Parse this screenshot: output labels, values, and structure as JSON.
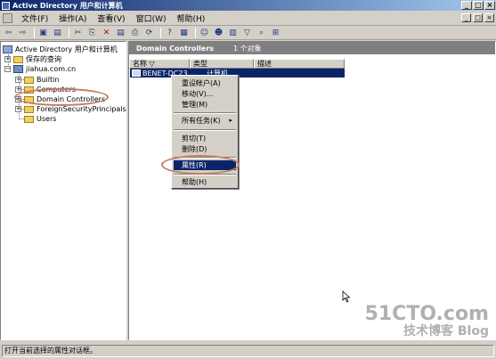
{
  "window": {
    "title": "Active Directory 用户和计算机",
    "minimize": "_",
    "maximize": "□",
    "close": "×"
  },
  "menubar": {
    "items": [
      "文件(F)",
      "操作(A)",
      "查看(V)",
      "窗口(W)",
      "帮助(H)"
    ],
    "controls": [
      "_",
      "□",
      "×"
    ]
  },
  "toolbar": {
    "icons": [
      "back-icon",
      "forward-icon",
      "up-icon",
      "show-tree-icon",
      "cut-icon",
      "copy-icon",
      "delete-icon",
      "properties-icon",
      "export-icon",
      "refresh-icon",
      "help-icon",
      "find-icon",
      "add-user-icon",
      "add-group-icon",
      "add-ou-icon",
      "filter-icon",
      "find-objects-icon",
      "add-to-group-icon"
    ],
    "glyphs": [
      "⇦",
      "⇨",
      "▣",
      "▤",
      "✂",
      "⎘",
      "✕",
      "▤",
      "⎙",
      "⟳",
      "?",
      "▦",
      "☺",
      "☻",
      "▥",
      "▽",
      "⌕",
      "⊞"
    ]
  },
  "tree": {
    "root": "Active Directory 用户和计算机",
    "saved_queries": "保存的查询",
    "domain": "jiahua.com.cn",
    "children": [
      "Builtin",
      "Computers",
      "Domain Controllers",
      "ForeignSecurityPrincipals",
      "Users"
    ]
  },
  "right_pane": {
    "title": "Domain Controllers",
    "count": "1 个对象",
    "columns": [
      "名称 ▽",
      "类型",
      "描述"
    ],
    "row": {
      "name": "BENET-DC23",
      "type": "计算机"
    }
  },
  "context_menu": {
    "items": [
      "重设帐户(A)",
      "移动(V)...",
      "管理(M)",
      "所有任务(K)",
      "剪切(T)",
      "删除(D)",
      "属性(R)",
      "帮助(H)"
    ],
    "submenu_arrow": "▸"
  },
  "status_bar": {
    "text": "打开当前选择的属性对话框。"
  },
  "watermark": {
    "line1": "51CTO.com",
    "line2": "技术博客 Blog"
  },
  "colors": {
    "title_gradient_start": "#0a246a",
    "selection": "#0a246a",
    "highlight_ring": "#c08060",
    "face": "#d4d0c8"
  }
}
